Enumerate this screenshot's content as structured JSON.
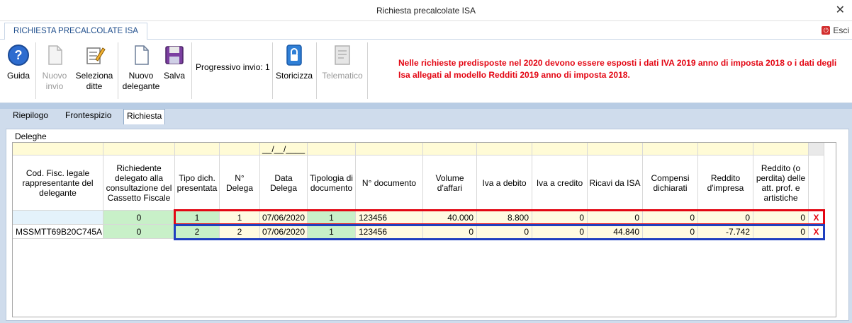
{
  "window": {
    "title": "Richiesta precalcolate ISA",
    "close_glyph": "✕"
  },
  "ribbon_tab": {
    "label": "RICHIESTA PRECALCOLATE ISA"
  },
  "esci": {
    "label": "Esci",
    "icon": "power-icon"
  },
  "toolbar": {
    "guida": "Guida",
    "nuovo_invio_1": "Nuovo",
    "nuovo_invio_2": "invio",
    "seleziona_1": "Seleziona",
    "seleziona_2": "ditte",
    "nuovo_del_1": "Nuovo",
    "nuovo_del_2": "delegante",
    "salva": "Salva",
    "progressivo": "Progressivo invio: 1",
    "storicizza": "Storicizza",
    "telematico": "Telematico"
  },
  "message": "Nelle richieste predisposte nel 2020 devono essere esposti i dati IVA 2019 anno di imposta 2018 o i dati degli Isa allegati al modello Redditi 2019 anno di imposta 2018.",
  "page_tabs": [
    "Riepilogo",
    "Frontespizio",
    "Richiesta"
  ],
  "group_title": "Deleghe",
  "date_filter": "__/__/____",
  "columns": [
    "Cod. Fisc. legale rappresentante del delegante",
    "Richiedente delegato alla consultazione del Cassetto Fiscale",
    "Tipo dich. presentata",
    "N° Delega",
    "Data Delega",
    "Tipologia di documento",
    "N° documento",
    "Volume d'affari",
    "Iva a debito",
    "Iva a credito",
    "Ricavi da ISA",
    "Compensi dichiarati",
    "Reddito d'impresa",
    "Reddito (o perdita) delle att. prof. e artistiche"
  ],
  "rows": [
    [
      "",
      "0",
      "1",
      "1",
      "07/06/2020",
      "1",
      "123456",
      "40.000",
      "8.800",
      "0",
      "0",
      "0",
      "0",
      "0"
    ],
    [
      "MSSMTT69B20C745A",
      "0",
      "2",
      "2",
      "07/06/2020",
      "1",
      "123456",
      "0",
      "0",
      "0",
      "44.840",
      "0",
      "-7.742",
      "0"
    ]
  ],
  "delete_glyph": "X"
}
